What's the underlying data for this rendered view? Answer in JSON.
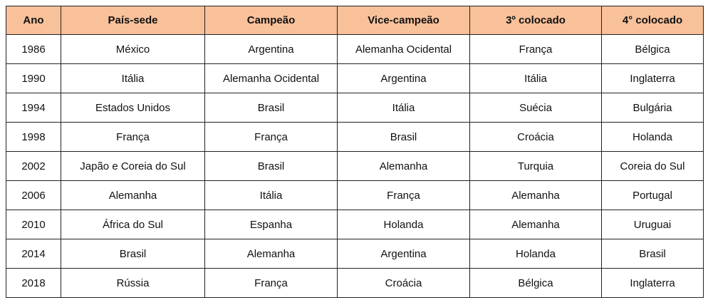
{
  "table": {
    "headers": [
      "Ano",
      "País-sede",
      "Campeão",
      "Vice-campeão",
      "3º colocado",
      "4° colocado"
    ],
    "rows": [
      [
        "1986",
        "México",
        "Argentina",
        "Alemanha Ocidental",
        "França",
        "Bélgica"
      ],
      [
        "1990",
        "Itália",
        "Alemanha Ocidental",
        "Argentina",
        "Itália",
        "Inglaterra"
      ],
      [
        "1994",
        "Estados Unidos",
        "Brasil",
        "Itália",
        "Suécia",
        "Bulgária"
      ],
      [
        "1998",
        "França",
        "França",
        "Brasil",
        "Croácia",
        "Holanda"
      ],
      [
        "2002",
        "Japão e Coreia do Sul",
        "Brasil",
        "Alemanha",
        "Turquia",
        "Coreia do Sul"
      ],
      [
        "2006",
        "Alemanha",
        "Itália",
        "França",
        "Alemanha",
        "Portugal"
      ],
      [
        "2010",
        "África do Sul",
        "Espanha",
        "Holanda",
        "Alemanha",
        "Uruguai"
      ],
      [
        "2014",
        "Brasil",
        "Alemanha",
        "Argentina",
        "Holanda",
        "Brasil"
      ],
      [
        "2018",
        "Rússia",
        "França",
        "Croácia",
        "Bélgica",
        "Inglaterra"
      ]
    ]
  },
  "colors": {
    "header_background": "#f8c19a",
    "border": "#222222",
    "text": "#111111"
  }
}
